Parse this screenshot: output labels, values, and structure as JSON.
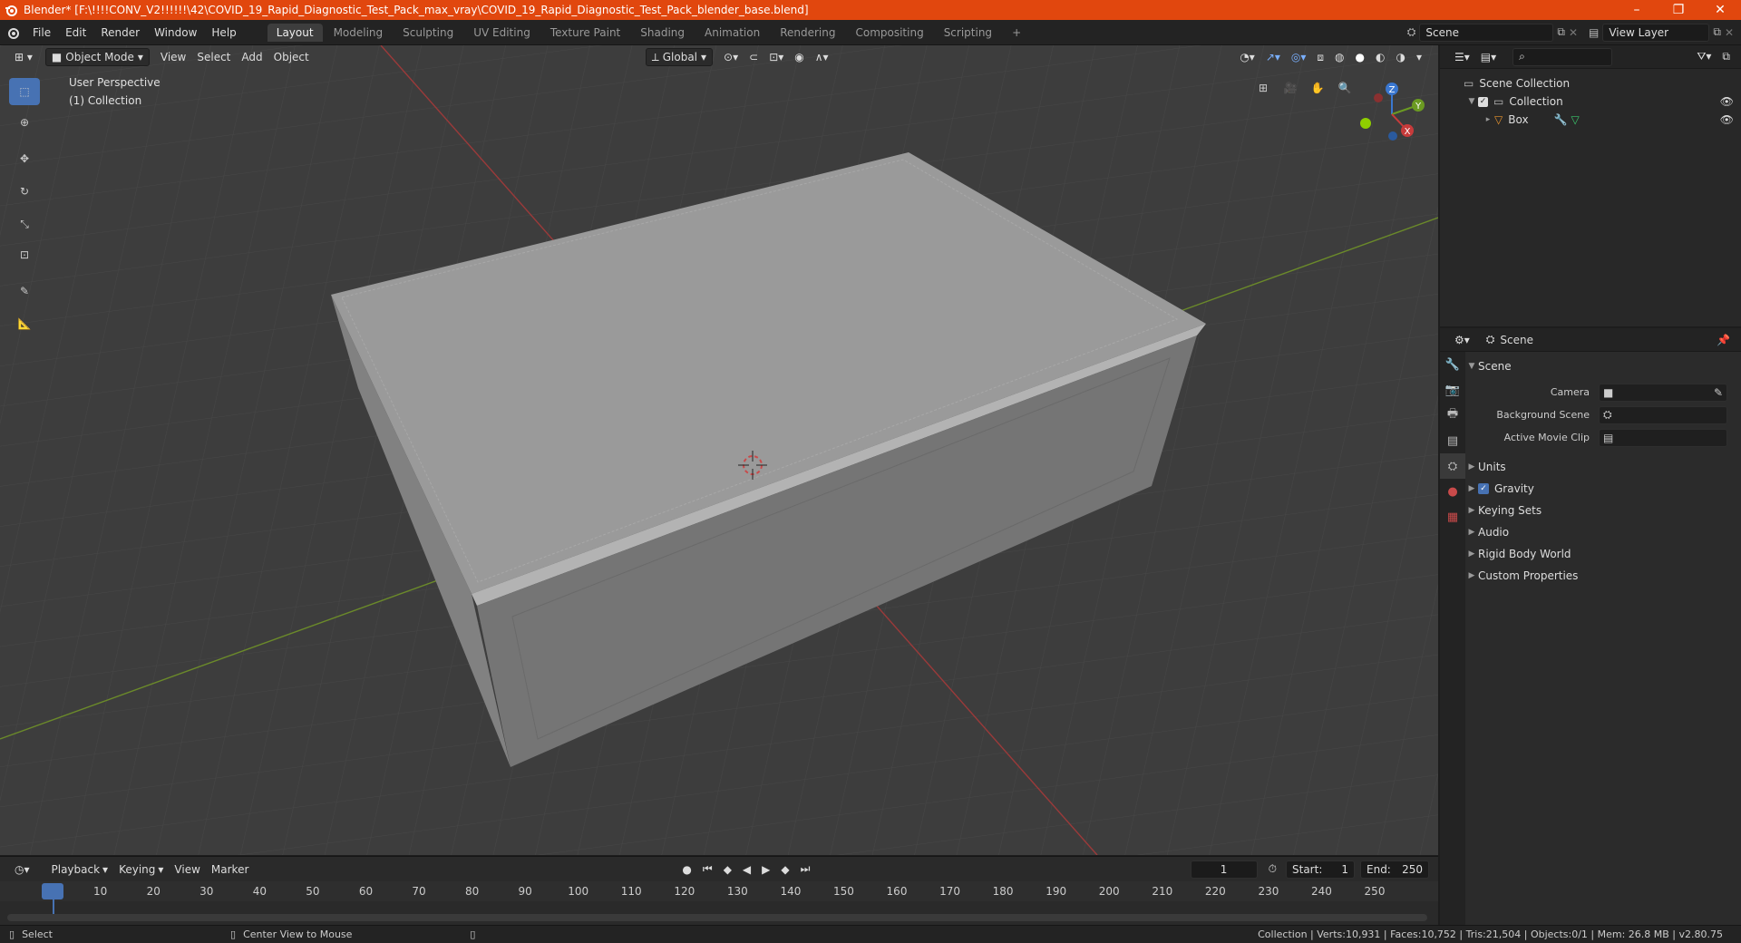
{
  "title_bar": {
    "title": "Blender* [F:\\!!!!CONV_V2!!!!!!\\42\\COVID_19_Rapid_Diagnostic_Test_Pack_max_vray\\COVID_19_Rapid_Diagnostic_Test_Pack_blender_base.blend]",
    "minimize": "–",
    "maximize": "❐",
    "close": "✕"
  },
  "menu": {
    "items": [
      "File",
      "Edit",
      "Render",
      "Window",
      "Help"
    ]
  },
  "workspaces": [
    "Layout",
    "Modeling",
    "Sculpting",
    "UV Editing",
    "Texture Paint",
    "Shading",
    "Animation",
    "Rendering",
    "Compositing",
    "Scripting"
  ],
  "add_workspace": "+",
  "scene_field": "Scene",
  "view_layer_field": "View Layer",
  "viewport": {
    "mode": "Object Mode",
    "menus": [
      "View",
      "Select",
      "Add",
      "Object"
    ],
    "orientation": "Global",
    "perspective_label": "User Perspective",
    "collection_label": "(1) Collection",
    "gizmo": {
      "z": "Z",
      "y": "Y",
      "x": "X"
    },
    "colors": {
      "background": "#3d3d3d",
      "grid": "#474747",
      "x_axis": "#9b3a3a",
      "y_axis": "#6b8a2a",
      "active_tool": "#4772b3"
    }
  },
  "timeline": {
    "menus": [
      "Playback",
      "Keying",
      "View",
      "Marker"
    ],
    "current_frame": "1",
    "start_label": "Start:",
    "start_value": "1",
    "end_label": "End:",
    "end_value": "250",
    "ticks": [
      "1",
      "10",
      "20",
      "30",
      "40",
      "50",
      "60",
      "70",
      "80",
      "90",
      "100",
      "110",
      "120",
      "130",
      "140",
      "150",
      "160",
      "170",
      "180",
      "190",
      "200",
      "210",
      "220",
      "230",
      "240",
      "250"
    ]
  },
  "outliner": {
    "search_placeholder": "",
    "scene_collection": "Scene Collection",
    "collection": "Collection",
    "object": "Box"
  },
  "properties": {
    "header": "Scene",
    "panel": "Scene",
    "camera_label": "Camera",
    "background_scene_label": "Background Scene",
    "active_movie_clip_label": "Active Movie Clip",
    "sections": [
      "Units",
      "Gravity",
      "Keying Sets",
      "Audio",
      "Rigid Body World",
      "Custom Properties"
    ]
  },
  "status": {
    "select": "Select",
    "center_view": "Center View to Mouse",
    "stats": "Collection | Verts:10,931 | Faces:10,752 | Tris:21,504 | Objects:0/1 | Mem: 26.8 MB | v2.80.75"
  }
}
